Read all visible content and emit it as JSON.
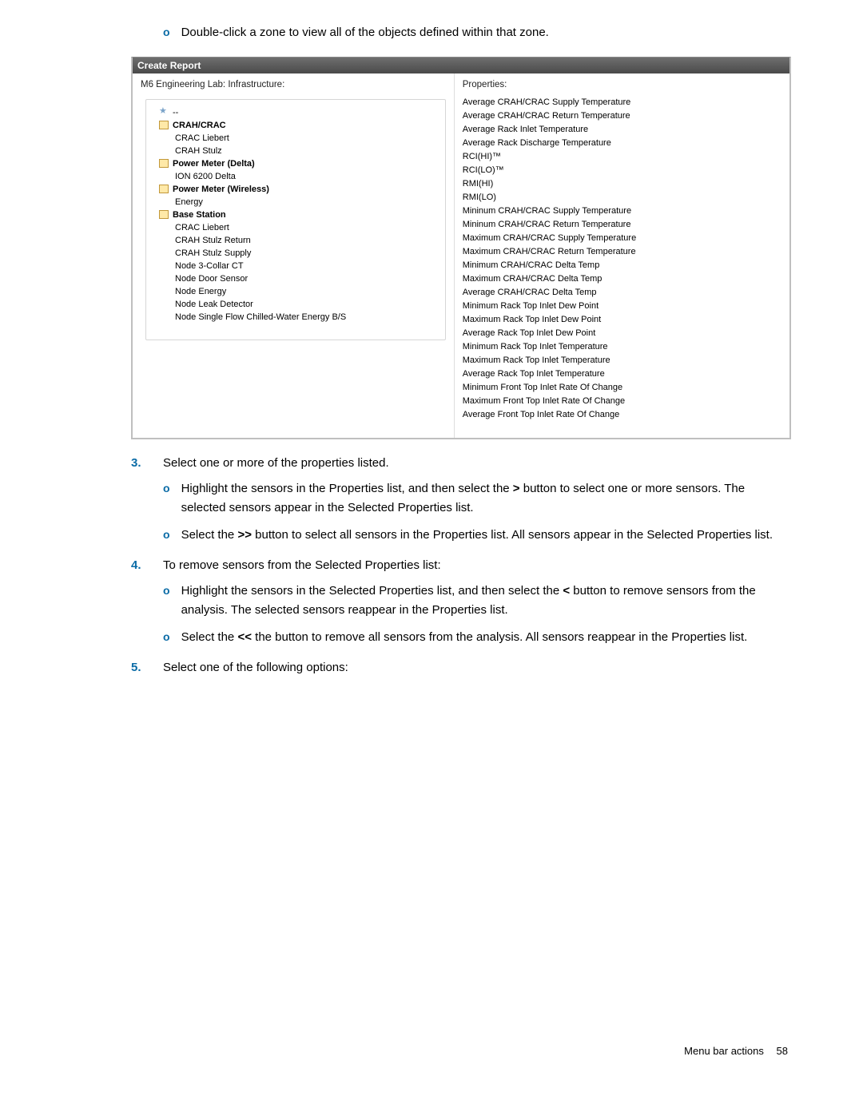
{
  "top_bullet": "Double-click a zone to view all of the objects defined within that zone.",
  "screenshot": {
    "window_title": "Create Report",
    "left_header": "M6 Engineering Lab: Infrastructure:",
    "right_header": "Properties:",
    "tree": [
      {
        "label": "--",
        "bold": false,
        "icon": "star",
        "level": 1
      },
      {
        "label": "CRAH/CRAC",
        "bold": true,
        "icon": "folder",
        "level": 1
      },
      {
        "label": "CRAC Liebert",
        "bold": false,
        "icon": null,
        "level": 2
      },
      {
        "label": "CRAH Stulz",
        "bold": false,
        "icon": null,
        "level": 2
      },
      {
        "label": "Power Meter (Delta)",
        "bold": true,
        "icon": "folder",
        "level": 1
      },
      {
        "label": "ION 6200 Delta",
        "bold": false,
        "icon": null,
        "level": 2
      },
      {
        "label": "Power Meter (Wireless)",
        "bold": true,
        "icon": "folder",
        "level": 1
      },
      {
        "label": "Energy",
        "bold": false,
        "icon": null,
        "level": 2
      },
      {
        "label": "Base Station",
        "bold": true,
        "icon": "folder",
        "level": 1
      },
      {
        "label": "CRAC Liebert",
        "bold": false,
        "icon": null,
        "level": 2
      },
      {
        "label": "CRAH Stulz Return",
        "bold": false,
        "icon": null,
        "level": 2
      },
      {
        "label": "CRAH Stulz Supply",
        "bold": false,
        "icon": null,
        "level": 2
      },
      {
        "label": "Node 3-Collar CT",
        "bold": false,
        "icon": null,
        "level": 2
      },
      {
        "label": "Node Door Sensor",
        "bold": false,
        "icon": null,
        "level": 2
      },
      {
        "label": "Node Energy",
        "bold": false,
        "icon": null,
        "level": 2
      },
      {
        "label": "Node Leak Detector",
        "bold": false,
        "icon": null,
        "level": 2
      },
      {
        "label": "Node Single Flow Chilled-Water Energy B/S",
        "bold": false,
        "icon": null,
        "level": 2
      }
    ],
    "properties": [
      "Average CRAH/CRAC Supply Temperature",
      "Average CRAH/CRAC Return Temperature",
      "Average Rack Inlet Temperature",
      "Average Rack Discharge Temperature",
      "RCI(HI)™",
      "RCI(LO)™",
      "RMI(HI)",
      "RMI(LO)",
      "Mininum CRAH/CRAC Supply Temperature",
      "Mininum CRAH/CRAC Return Temperature",
      "Maximum CRAH/CRAC Supply Temperature",
      "Maximum CRAH/CRAC Return Temperature",
      "Minimum CRAH/CRAC Delta Temp",
      "Maximum CRAH/CRAC Delta Temp",
      "Average CRAH/CRAC Delta Temp",
      "Minimum Rack Top Inlet Dew Point",
      "Maximum Rack Top Inlet Dew Point",
      "Average Rack Top Inlet Dew Point",
      "Minimum Rack Top Inlet Temperature",
      "Maximum Rack Top Inlet Temperature",
      "Average Rack Top Inlet Temperature",
      "Minimum Front Top Inlet Rate Of Change",
      "Maximum Front Top Inlet Rate Of Change",
      "Average Front Top Inlet Rate Of Change"
    ]
  },
  "steps": {
    "s3": {
      "num": "3.",
      "text": "Select one or more of the properties listed.",
      "b1a": "Highlight the sensors in the Properties list, and then select the ",
      "b1b": ">",
      "b1c": " button to select one or more sensors. The selected sensors appear in the Selected Properties list.",
      "b2a": "Select the ",
      "b2b": ">>",
      "b2c": " button to select all sensors in the Properties list. All sensors appear in the Selected Properties list."
    },
    "s4": {
      "num": "4.",
      "text": "To remove sensors from the Selected Properties list:",
      "b1a": "Highlight the sensors in the Selected Properties list, and then select the ",
      "b1b": "<",
      "b1c": " button to remove sensors from the analysis. The selected sensors reappear in the Properties list.",
      "b2a": "Select the ",
      "b2b": "<<",
      "b2c": " the button to remove all sensors from the analysis. All sensors reappear in the Properties list."
    },
    "s5": {
      "num": "5.",
      "text": "Select one of the following options:"
    }
  },
  "footer": {
    "section": "Menu bar actions",
    "page": "58"
  }
}
